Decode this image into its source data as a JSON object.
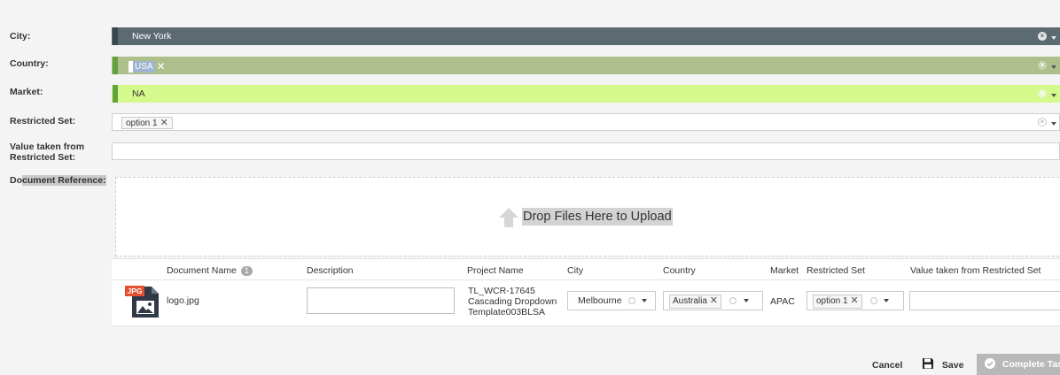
{
  "form": {
    "city_label": "City:",
    "city_value": "New York",
    "country_label": "Country:",
    "country_chip": "USA",
    "market_label": "Market:",
    "market_value": "NA",
    "restricted_label": "Restricted Set:",
    "restricted_chip": "option 1",
    "value_taken_label_1": "Value taken from",
    "value_taken_label_2": "Restricted Set:",
    "doc_ref_label_a": "Do",
    "doc_ref_label_b": "cument Reference:"
  },
  "upload": {
    "drop_text": "Drop Files Here to Upload"
  },
  "table": {
    "headers": {
      "doc_name": "Document Name",
      "doc_count": "1",
      "description": "Description",
      "project": "Project Name",
      "city": "City",
      "country": "Country",
      "market": "Market",
      "restricted": "Restricted Set",
      "value_taken": "Value taken from Restricted Set"
    },
    "row": {
      "file_badge": "JPG",
      "file_name": "logo.jpg",
      "description": "",
      "project_line1": "TL_WCR-17645",
      "project_line2": "Cascading Dropdown",
      "project_line3": "Template003BLSA",
      "city": "Melbourne",
      "country": "Australia",
      "market": "APAC",
      "restricted": "option 1",
      "value_taken": ""
    }
  },
  "footer": {
    "cancel": "Cancel",
    "save": "Save",
    "complete": "Complete Task"
  },
  "colors": {
    "city_fill": "#5c6a72",
    "city_edge": "#3b474e",
    "country_fill": "#aebf8c",
    "country_edge": "#63a23e",
    "market_fill": "#d4f98c",
    "market_edge": "#63a23e"
  },
  "icons": {
    "clear": "x-circle-icon",
    "caret": "chevron-down-icon",
    "upload": "upload-arrow-icon",
    "file": "jpg-file-icon",
    "save": "floppy-disk-icon",
    "complete": "check-circle-icon"
  }
}
